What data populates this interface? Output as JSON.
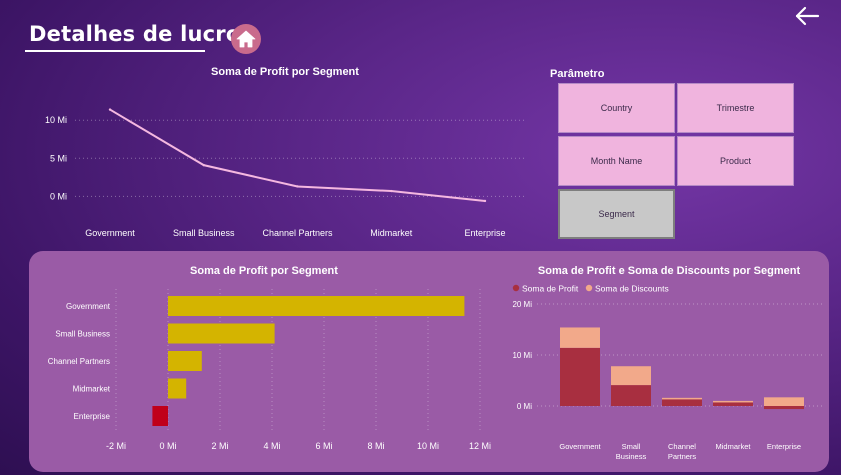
{
  "header": {
    "title": "Detalhes de lucro",
    "home_icon": "home-icon",
    "back_icon": "arrow-left-icon"
  },
  "slicer": {
    "title": "Parâmetro",
    "items": [
      {
        "label": "Country",
        "selected": false
      },
      {
        "label": "Trimestre",
        "selected": false
      },
      {
        "label": "Month Name",
        "selected": false
      },
      {
        "label": "Product",
        "selected": false
      },
      {
        "label": "Segment",
        "selected": true
      }
    ]
  },
  "chart_data": [
    {
      "type": "line",
      "title": "Soma de Profit por Segment",
      "categories": [
        "Government",
        "Small Business",
        "Channel Partners",
        "Midmarket",
        "Enterprise"
      ],
      "values": [
        11.4,
        4.1,
        1.3,
        0.7,
        -0.6
      ],
      "y_ticks": [
        "10 Mi",
        "5 Mi",
        "0 Mi"
      ],
      "ylim": [
        -1,
        12
      ],
      "color": "#f5b8e0"
    },
    {
      "type": "bar",
      "orientation": "horizontal",
      "title": "Soma de Profit por Segment",
      "categories": [
        "Government",
        "Small Business",
        "Channel Partners",
        "Midmarket",
        "Enterprise"
      ],
      "values": [
        11.4,
        4.1,
        1.3,
        0.7,
        -0.6
      ],
      "x_ticks": [
        "-2 Mi",
        "0 Mi",
        "2 Mi",
        "4 Mi",
        "6 Mi",
        "8 Mi",
        "10 Mi",
        "12 Mi"
      ],
      "xlim": [
        -2,
        12
      ],
      "color_positive": "#d4b400",
      "color_negative": "#c0001a"
    },
    {
      "type": "bar",
      "stacked": true,
      "title": "Soma de Profit e Soma de Discounts por Segment",
      "categories": [
        "Government",
        "Small Business",
        "Channel Partners",
        "Midmarket",
        "Enterprise"
      ],
      "category_lines": [
        [
          "Government"
        ],
        [
          "Small",
          "Business"
        ],
        [
          "Channel",
          "Partners"
        ],
        [
          "Midmarket"
        ],
        [
          "Enterprise"
        ]
      ],
      "series": [
        {
          "name": "Soma de Profit",
          "values": [
            11.4,
            4.1,
            1.3,
            0.7,
            -0.6
          ],
          "color": "#a82f40"
        },
        {
          "name": "Soma de Discounts",
          "values": [
            4.0,
            3.7,
            0.3,
            0.3,
            1.7
          ],
          "color": "#f2a98a"
        }
      ],
      "y_ticks": [
        "20 Mi",
        "10 Mi",
        "0 Mi"
      ],
      "ylim": [
        0,
        20
      ]
    }
  ]
}
